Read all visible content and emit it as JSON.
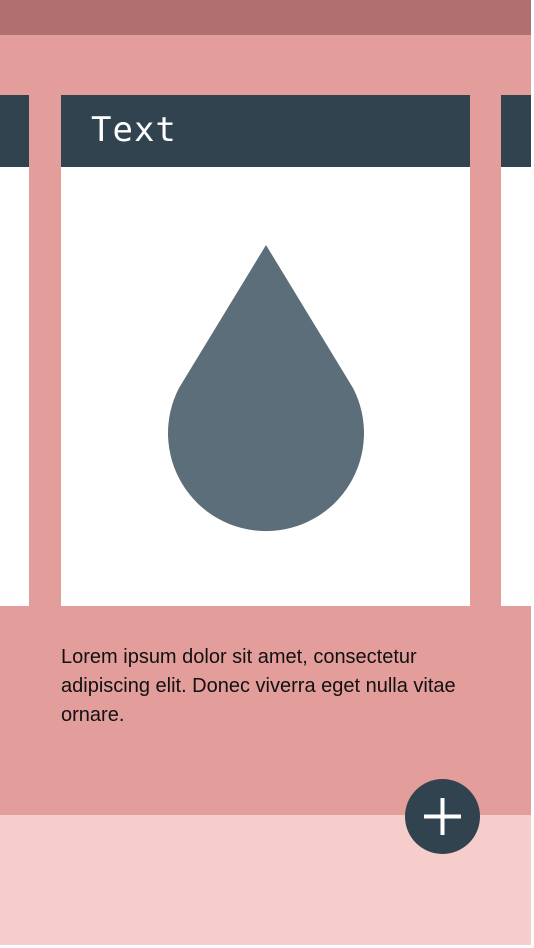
{
  "card": {
    "title": "Text",
    "image_icon": "water-drop-icon",
    "body": "Lorem ipsum dolor sit amet, consectetur adipiscing elit. Donec viverra eget nulla vitae ornare."
  },
  "fab": {
    "icon": "plus-icon"
  },
  "colors": {
    "status_bar": "#b07070",
    "app_background": "#e39d9a",
    "bottom_background": "#f6cdcb",
    "header": "#31434f",
    "drop": "#5c6e79",
    "fab": "#31434f"
  }
}
